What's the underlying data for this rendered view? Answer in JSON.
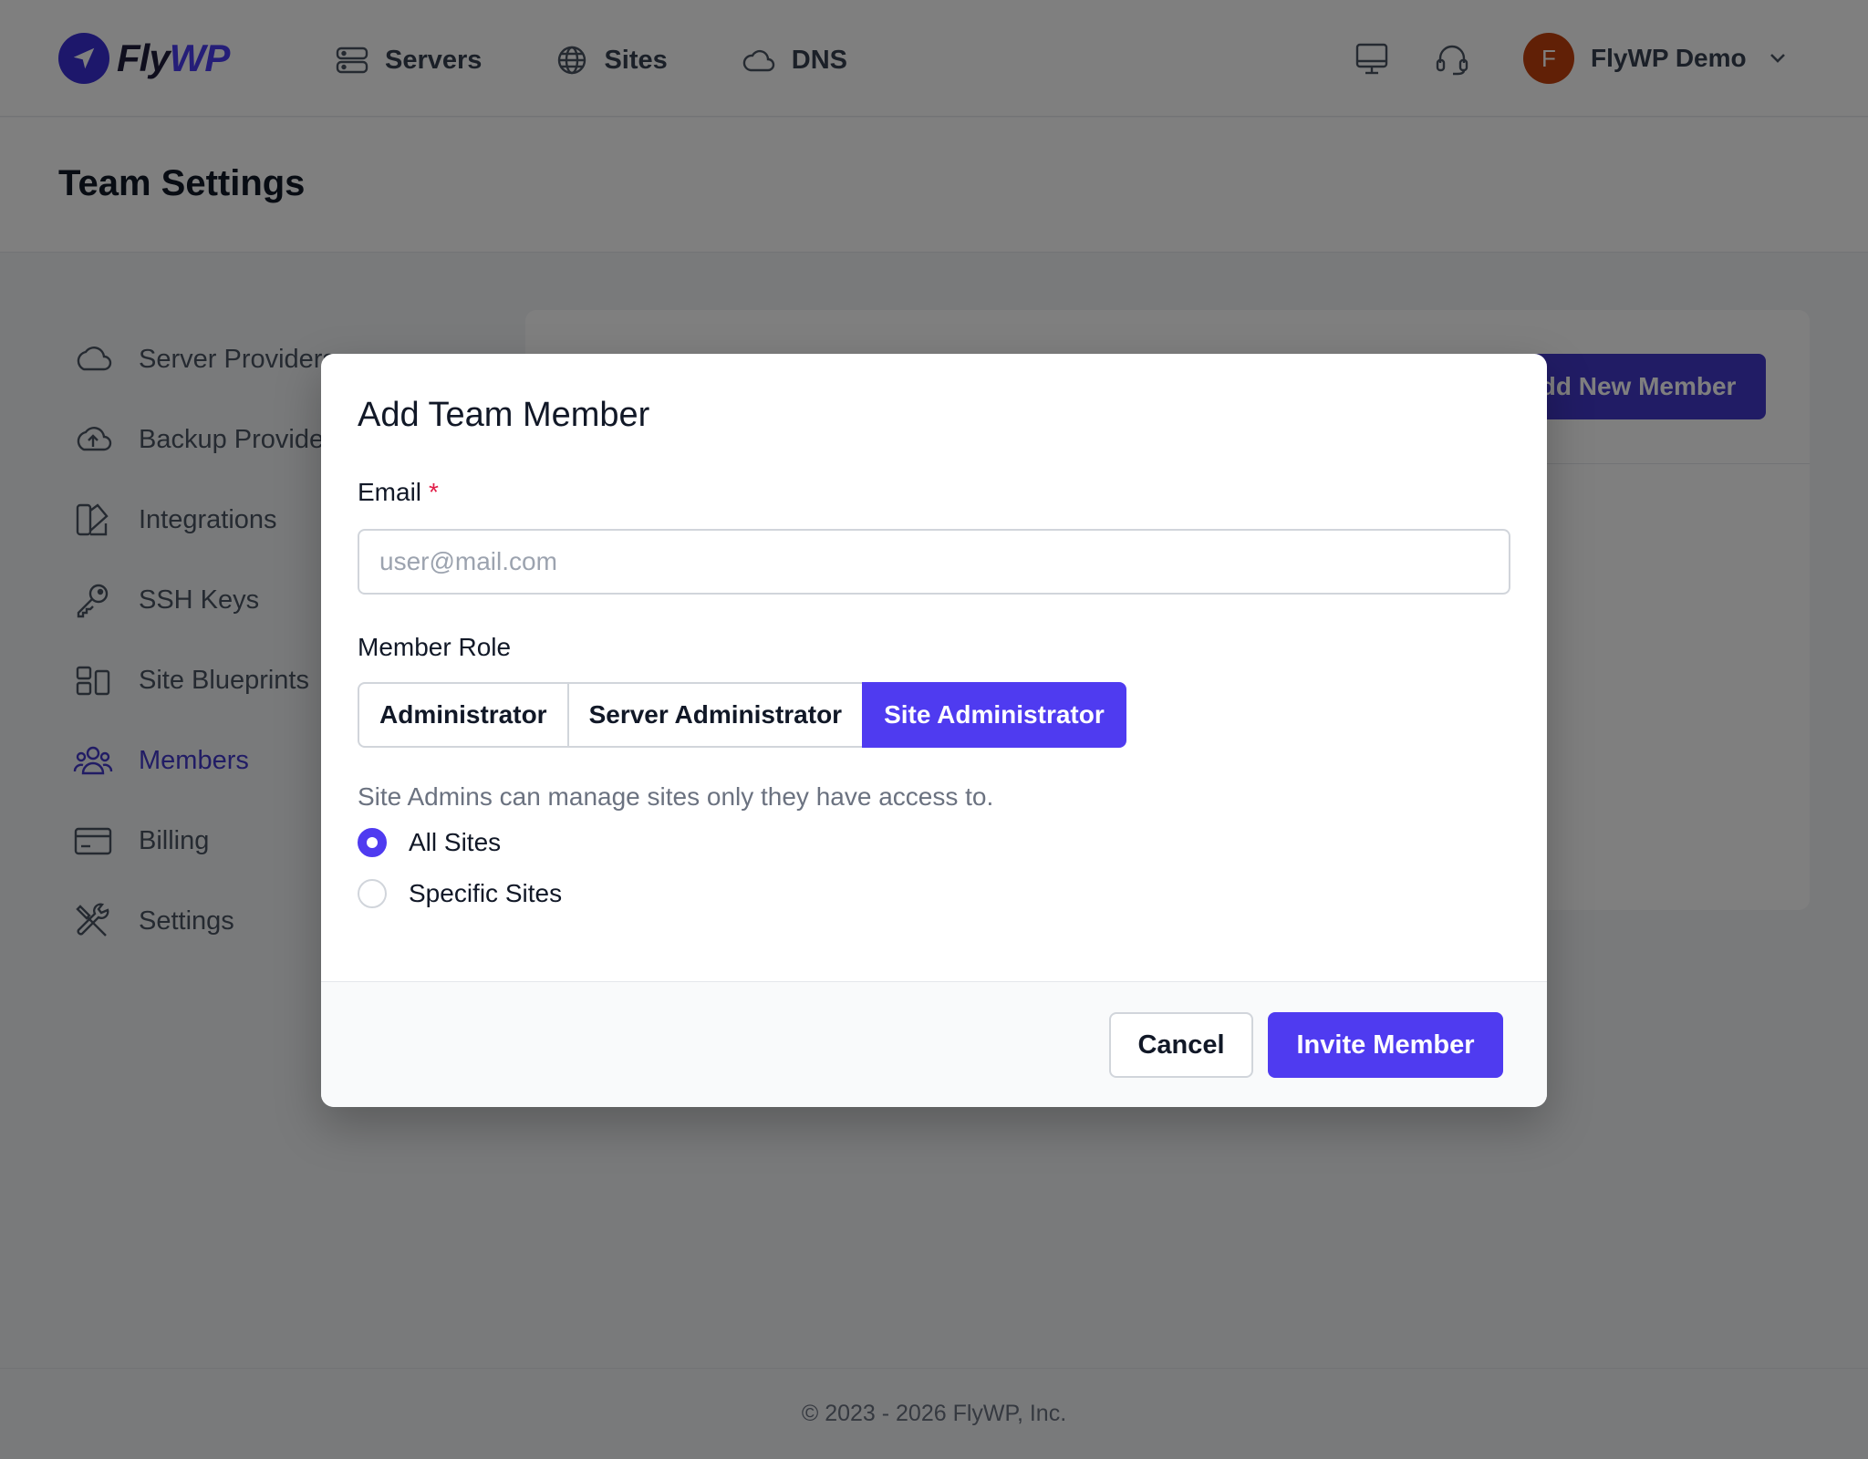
{
  "header": {
    "logo": {
      "part1": "Fly",
      "part2": "WP"
    },
    "nav": [
      {
        "label": "Servers",
        "icon": "server-icon"
      },
      {
        "label": "Sites",
        "icon": "globe-icon"
      },
      {
        "label": "DNS",
        "icon": "cloud-icon"
      }
    ],
    "user": {
      "initial": "F",
      "name": "FlyWP Demo"
    },
    "colors": {
      "brand": "#4b3df0",
      "avatar": "#c2410c"
    }
  },
  "page": {
    "title": "Team Settings"
  },
  "sidebar": {
    "items": [
      {
        "label": "Server Providers",
        "icon": "cloud-icon",
        "active": false
      },
      {
        "label": "Backup Providers",
        "icon": "cloud-upload-icon",
        "active": false
      },
      {
        "label": "Integrations",
        "icon": "integrations-icon",
        "active": false
      },
      {
        "label": "SSH Keys",
        "icon": "key-icon",
        "active": false
      },
      {
        "label": "Site Blueprints",
        "icon": "blueprint-icon",
        "active": false
      },
      {
        "label": "Members",
        "icon": "users-icon",
        "active": true
      },
      {
        "label": "Billing",
        "icon": "credit-card-icon",
        "active": false
      },
      {
        "label": "Settings",
        "icon": "tools-icon",
        "active": false
      }
    ]
  },
  "content": {
    "add_button": "Add New Member"
  },
  "modal": {
    "title": "Add Team Member",
    "email": {
      "label": "Email",
      "required_mark": "*",
      "placeholder": "user@mail.com",
      "value": ""
    },
    "role": {
      "label": "Member Role",
      "options": [
        "Administrator",
        "Server Administrator",
        "Site Administrator"
      ],
      "selected": "Site Administrator",
      "description": "Site Admins can manage sites only they have access to."
    },
    "access": {
      "options": [
        "All Sites",
        "Specific Sites"
      ],
      "selected": "All Sites"
    },
    "cancel_label": "Cancel",
    "invite_label": "Invite Member",
    "colors": {
      "primary": "#4f3bf0",
      "required": "#e11d48"
    }
  },
  "footer": {
    "copyright": "© 2023 - 2026 FlyWP, Inc."
  }
}
